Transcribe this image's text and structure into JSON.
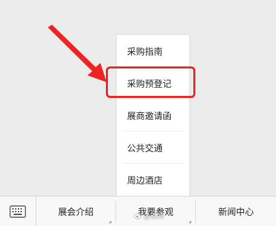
{
  "popup_menu": {
    "items": [
      {
        "label": "采购指南"
      },
      {
        "label": "采购预登记"
      },
      {
        "label": "展商邀请函"
      },
      {
        "label": "公共交通"
      },
      {
        "label": "周边酒店"
      }
    ],
    "highlighted_index": 1
  },
  "menu_bar": {
    "keyboard_icon": "keyboard-icon",
    "tabs": [
      {
        "label": "展会介绍",
        "has_submenu": true
      },
      {
        "label": "我要参观",
        "has_submenu": true
      },
      {
        "label": "新闻中心",
        "has_submenu": false
      }
    ]
  },
  "watermark": {
    "text": "@新闻"
  },
  "colors": {
    "annotation_red": "#ee2323",
    "menu_bg": "#ffffff",
    "bar_bg": "#f8f8f8",
    "screen_bg": "#ececec"
  }
}
